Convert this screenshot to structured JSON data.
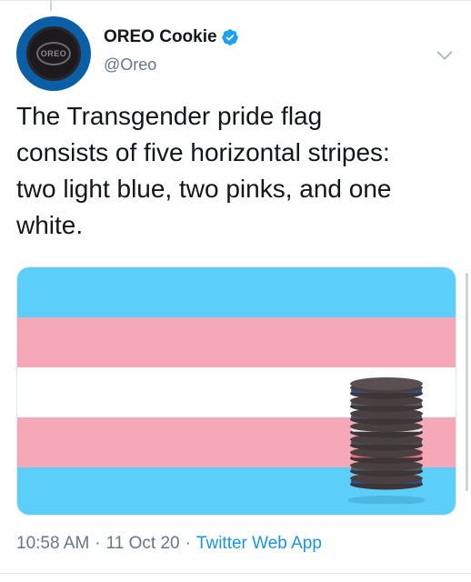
{
  "tweet": {
    "display_name": "OREO Cookie",
    "handle": "@Oreo",
    "avatar_text": "OREO",
    "text": "The Transgender pride flag\nconsists of five horizontal stripes:\ntwo light blue, two pinks, and one\nwhite.",
    "time": "10:58 AM",
    "date": "11 Oct 20",
    "source": "Twitter Web App",
    "separator": "·",
    "icons": {
      "verified": "verified-badge-icon",
      "more": "chevron-down-icon"
    }
  },
  "media": {
    "flag_colors": {
      "blue": "#5bcefa",
      "pink": "#f5a9b8",
      "white": "#ffffff"
    },
    "stripe_order": [
      "blue",
      "pink",
      "white",
      "pink",
      "blue"
    ],
    "cookie_stack": {
      "cream_colors": [
        "#2f4f8f",
        "#555a68",
        "#4a4e59",
        "#e7e5e9",
        "#4a4e59",
        "#f06b86",
        "#555a68",
        "#2f4f8f"
      ],
      "wafer_color": "#3d3536"
    }
  },
  "colors": {
    "text": "#14171a",
    "secondary": "#657786",
    "link": "#1b95e0",
    "verified": "#1da1f2"
  }
}
